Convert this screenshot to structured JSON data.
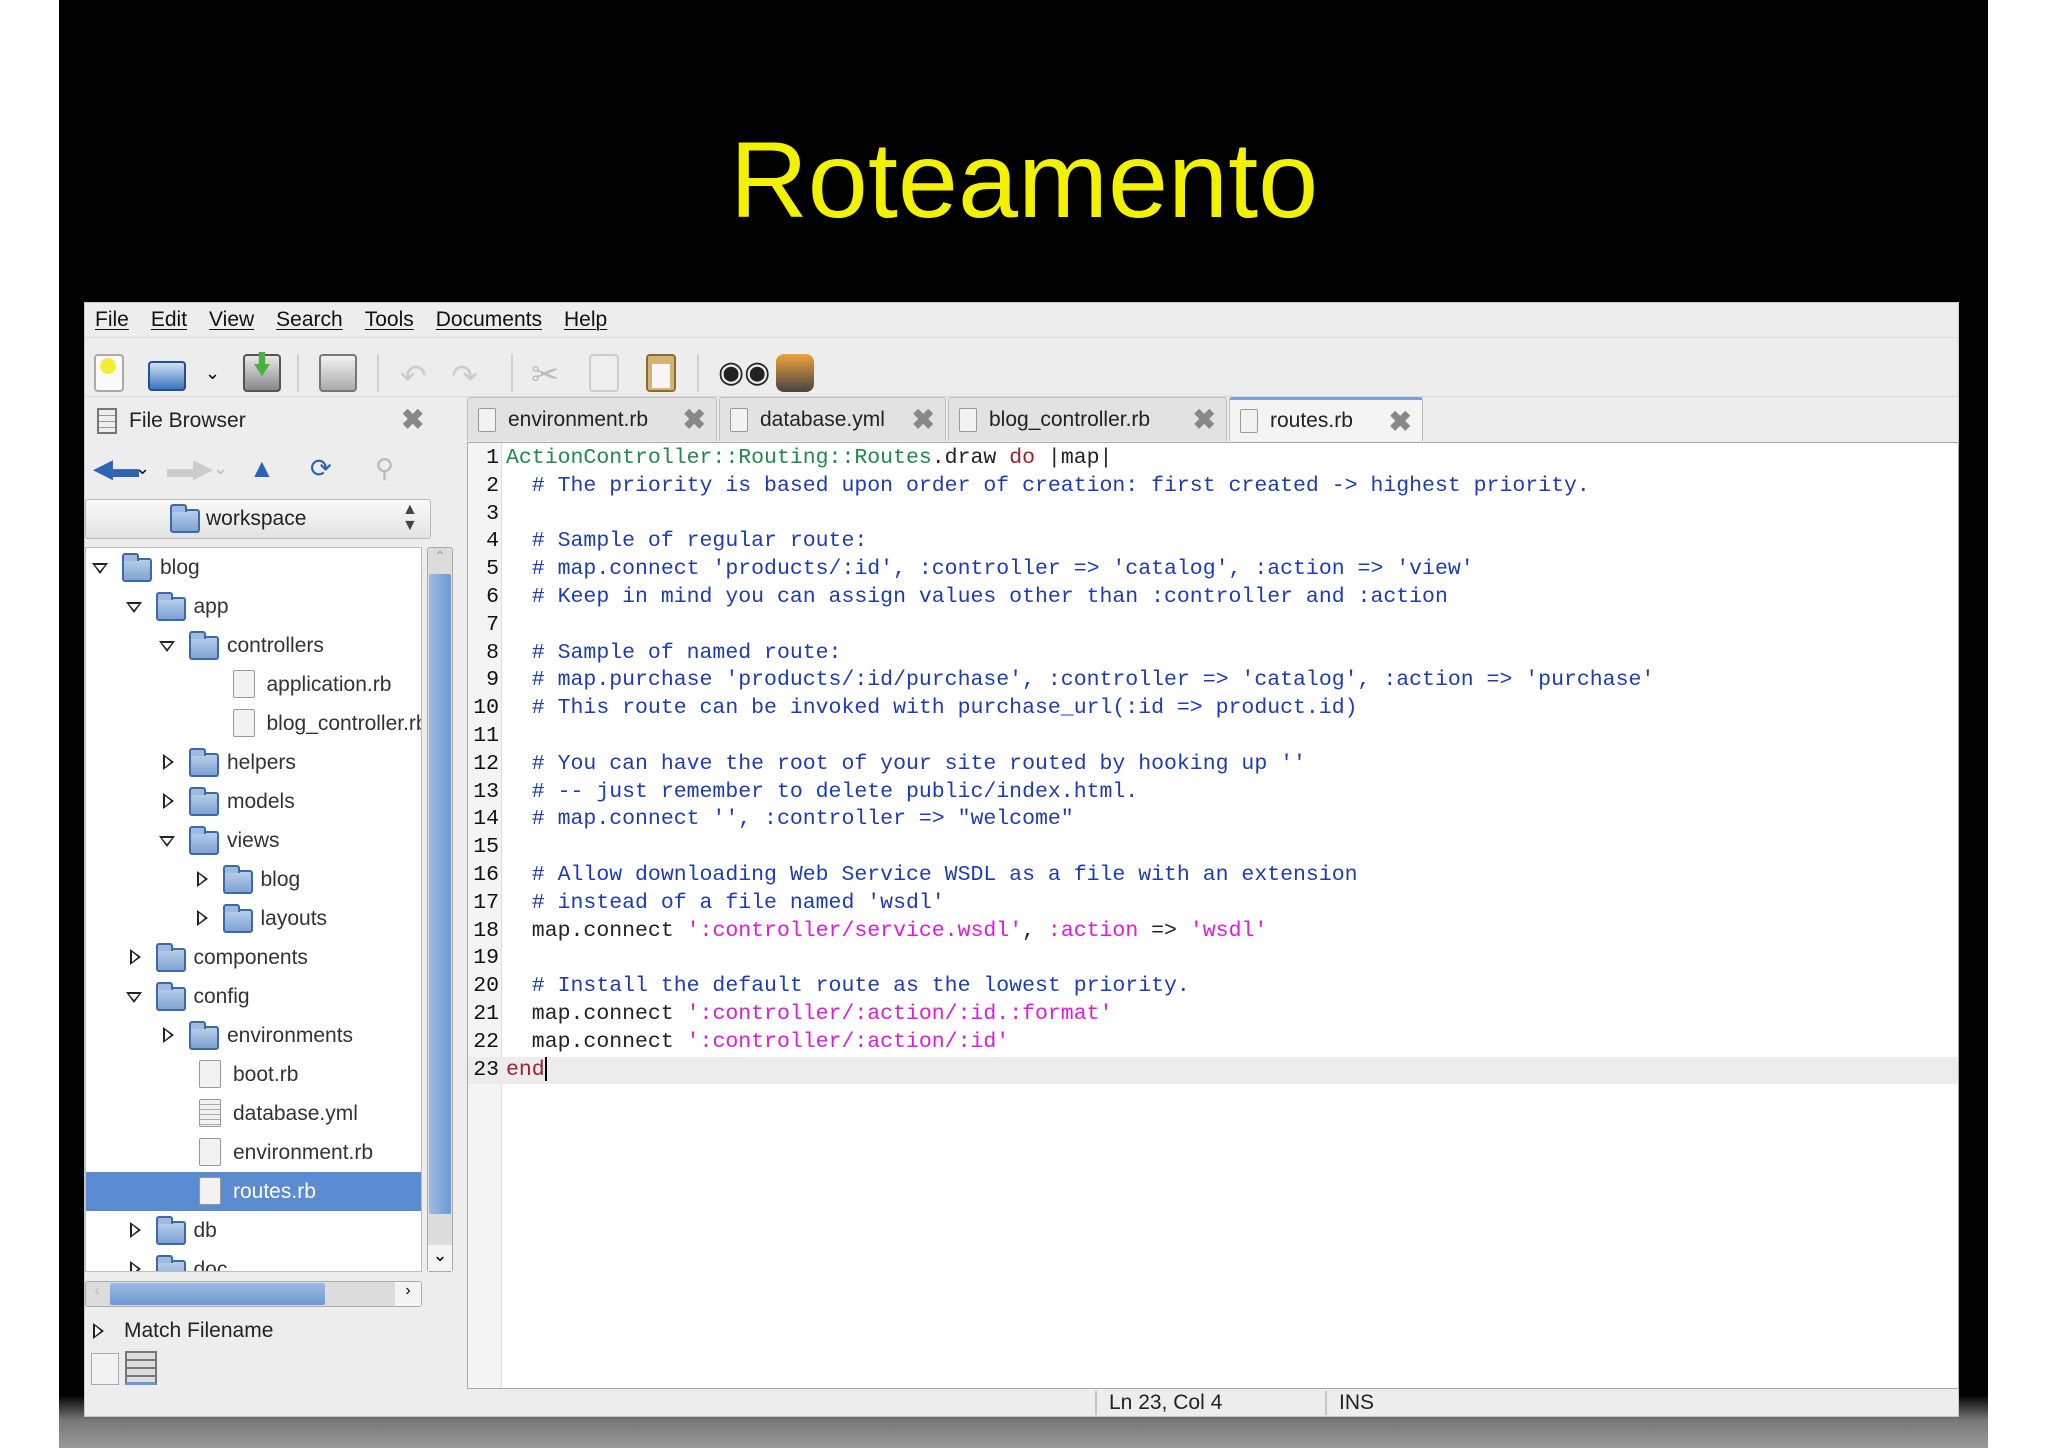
{
  "slide": {
    "title": "Roteamento",
    "title_color": "#f2f200"
  },
  "menu": [
    "File",
    "Edit",
    "View",
    "Search",
    "Tools",
    "Documents",
    "Help"
  ],
  "toolbar": {
    "icons": [
      "new-document-icon",
      "open-icon",
      "open-dropdown-icon",
      "save-icon",
      "print-icon",
      "undo-icon",
      "redo-icon",
      "cut-icon",
      "copy-icon",
      "paste-icon",
      "find-icon",
      "find-replace-icon"
    ]
  },
  "sidebar": {
    "title": "File Browser",
    "location": "workspace",
    "tree": [
      {
        "level": 0,
        "type": "folder",
        "state": "open",
        "name": "blog"
      },
      {
        "level": 1,
        "type": "folder",
        "state": "open",
        "name": "app"
      },
      {
        "level": 2,
        "type": "folder",
        "state": "open",
        "name": "controllers"
      },
      {
        "level": 3,
        "type": "file",
        "name": "application.rb"
      },
      {
        "level": 3,
        "type": "file",
        "name": "blog_controller.rb"
      },
      {
        "level": 2,
        "type": "folder",
        "state": "closed",
        "name": "helpers"
      },
      {
        "level": 2,
        "type": "folder",
        "state": "closed",
        "name": "models"
      },
      {
        "level": 2,
        "type": "folder",
        "state": "open",
        "name": "views"
      },
      {
        "level": 3,
        "type": "folder",
        "state": "closed",
        "name": "blog"
      },
      {
        "level": 3,
        "type": "folder",
        "state": "closed",
        "name": "layouts"
      },
      {
        "level": 1,
        "type": "folder",
        "state": "closed",
        "name": "components"
      },
      {
        "level": 1,
        "type": "folder",
        "state": "open",
        "name": "config"
      },
      {
        "level": 2,
        "type": "folder",
        "state": "closed",
        "name": "environments"
      },
      {
        "level": 2,
        "type": "file",
        "name": "boot.rb"
      },
      {
        "level": 2,
        "type": "txt",
        "name": "database.yml"
      },
      {
        "level": 2,
        "type": "file",
        "name": "environment.rb"
      },
      {
        "level": 2,
        "type": "file",
        "name": "routes.rb",
        "selected": true
      },
      {
        "level": 1,
        "type": "folder",
        "state": "closed",
        "name": "db"
      },
      {
        "level": 1,
        "type": "folder",
        "state": "closed",
        "name": "doc"
      }
    ],
    "match_filename": "Match Filename"
  },
  "tabs": [
    {
      "label": "environment.rb",
      "active": false
    },
    {
      "label": "database.yml",
      "active": false
    },
    {
      "label": "blog_controller.rb",
      "active": false
    },
    {
      "label": "routes.rb",
      "active": true
    }
  ],
  "code": [
    [
      [
        "const",
        "ActionController::Routing::Routes"
      ],
      [
        "plain",
        ".draw "
      ],
      [
        "kw",
        "do"
      ],
      [
        "plain",
        " |map|"
      ]
    ],
    [
      [
        "comment",
        "  # The priority is based upon order of creation: first created -> highest priority."
      ]
    ],
    [],
    [
      [
        "comment",
        "  # Sample of regular route:"
      ]
    ],
    [
      [
        "comment",
        "  # map.connect 'products/:id', :controller => 'catalog', :action => 'view'"
      ]
    ],
    [
      [
        "comment",
        "  # Keep in mind you can assign values other than :controller and :action"
      ]
    ],
    [],
    [
      [
        "comment",
        "  # Sample of named route:"
      ]
    ],
    [
      [
        "comment",
        "  # map.purchase 'products/:id/purchase', :controller => 'catalog', :action => 'purchase'"
      ]
    ],
    [
      [
        "comment",
        "  # This route can be invoked with purchase_url(:id => product.id)"
      ]
    ],
    [],
    [
      [
        "comment",
        "  # You can have the root of your site routed by hooking up ''"
      ]
    ],
    [
      [
        "comment",
        "  # -- just remember to delete public/index.html."
      ]
    ],
    [
      [
        "comment",
        "  # map.connect '', :controller => \"welcome\""
      ]
    ],
    [],
    [
      [
        "comment",
        "  # Allow downloading Web Service WSDL as a file with an extension"
      ]
    ],
    [
      [
        "comment",
        "  # instead of a file named 'wsdl'"
      ]
    ],
    [
      [
        "plain",
        "  map.connect "
      ],
      [
        "str",
        "':controller/service.wsdl'"
      ],
      [
        "plain",
        ", "
      ],
      [
        "str",
        ":action"
      ],
      [
        "plain",
        " => "
      ],
      [
        "str",
        "'wsdl'"
      ]
    ],
    [],
    [
      [
        "comment",
        "  # Install the default route as the lowest priority."
      ]
    ],
    [
      [
        "plain",
        "  map.connect "
      ],
      [
        "str",
        "':controller/:action/:id.:format'"
      ]
    ],
    [
      [
        "plain",
        "  map.connect "
      ],
      [
        "str",
        "':controller/:action/:id'"
      ]
    ],
    [
      [
        "kw",
        "end"
      ]
    ]
  ],
  "current_line": 23,
  "status": {
    "position": "Ln 23, Col 4",
    "mode": "INS"
  }
}
